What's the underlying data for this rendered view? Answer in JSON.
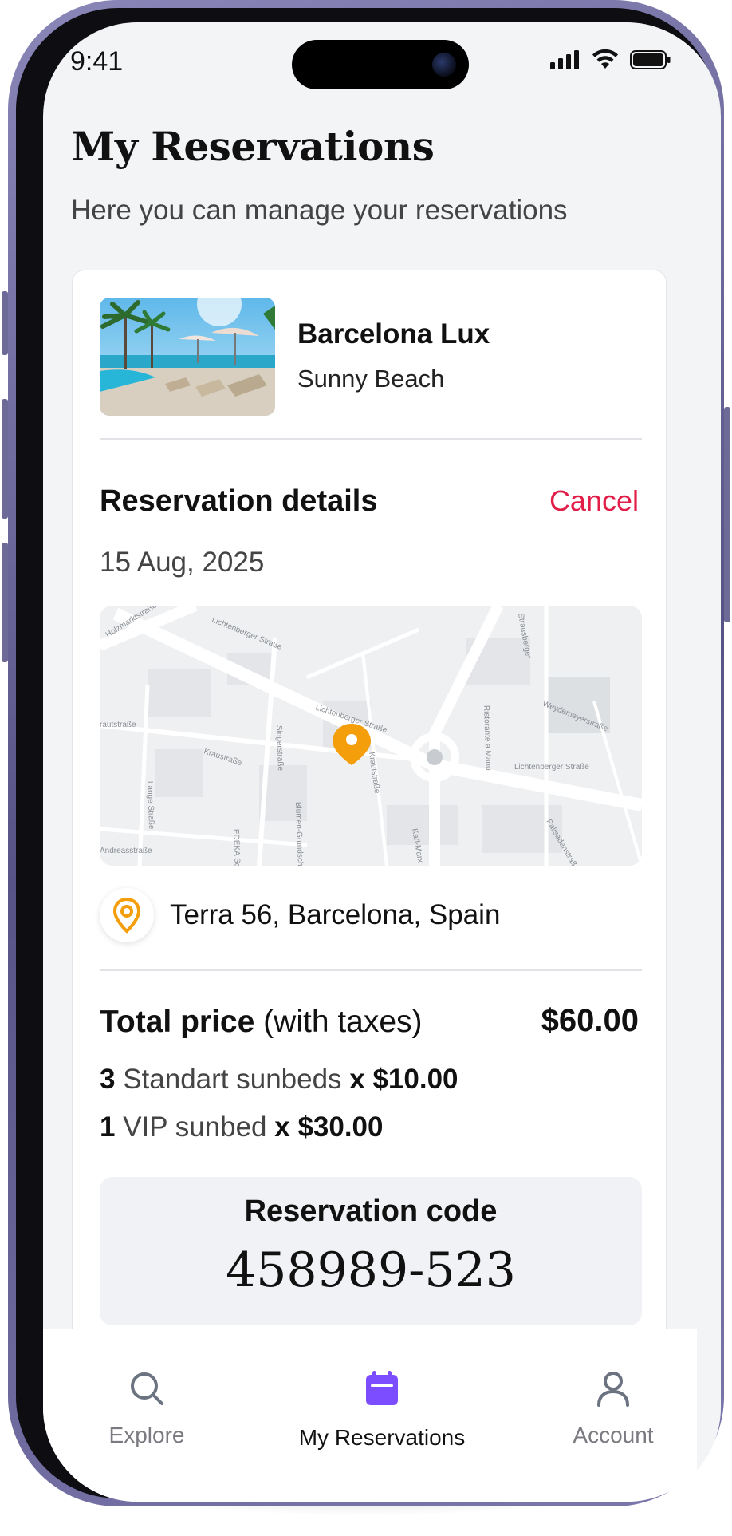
{
  "status_bar": {
    "time": "9:41"
  },
  "header": {
    "title": "My Reservations",
    "subtitle": "Here you can manage your reservations"
  },
  "reservation": {
    "hotel_name": "Barcelona Lux",
    "beach_name": "Sunny Beach",
    "details_title": "Reservation details",
    "cancel_label": "Cancel",
    "date": "15 Aug, 2025",
    "address": "Terra 56, Barcelona, Spain",
    "total_label_bold": "Total price",
    "total_label_rest": " (with taxes)",
    "total_value": "$60.00",
    "items": [
      {
        "qty": "3",
        "name": " Standart sunbeds ",
        "price": "x $10.00"
      },
      {
        "qty": "1",
        "name": " VIP sunbed ",
        "price": "x $30.00"
      }
    ],
    "code_label": "Reservation code",
    "code_value": "458989-523"
  },
  "map_labels": {
    "street_1": "Lichtenberger Straße",
    "street_2": "Lichtenberger Straße",
    "street_3": "Lichtenberger Straße",
    "street_4": "Weydemeyerstraße",
    "street_5": "Singerstraße",
    "street_6": "Kraustraße",
    "street_7": "Krautstraße",
    "street_8": "Blumen-Grundschule",
    "street_9": "Lange Straße",
    "street_10": "Andreasstraße",
    "street_11": "Karl-Marx",
    "street_12": "Ristorante a Mano",
    "street_13": "EDEKA Sc",
    "street_14": "Palisadenstraße",
    "street_15": "Kraustraße",
    "street_16": "rautstraße",
    "street_17": "Strausberger",
    "street_18": "Holzmarktstraße"
  },
  "tabbar": {
    "tabs": [
      {
        "label": "Explore",
        "icon": "search-icon"
      },
      {
        "label": "My Reservations",
        "icon": "calendar-icon"
      },
      {
        "label": "Account",
        "icon": "user-icon"
      }
    ],
    "active_index": 1
  },
  "colors": {
    "accent": "#7c4dff",
    "cancel": "#e11d48",
    "pin": "#f59e0b"
  }
}
